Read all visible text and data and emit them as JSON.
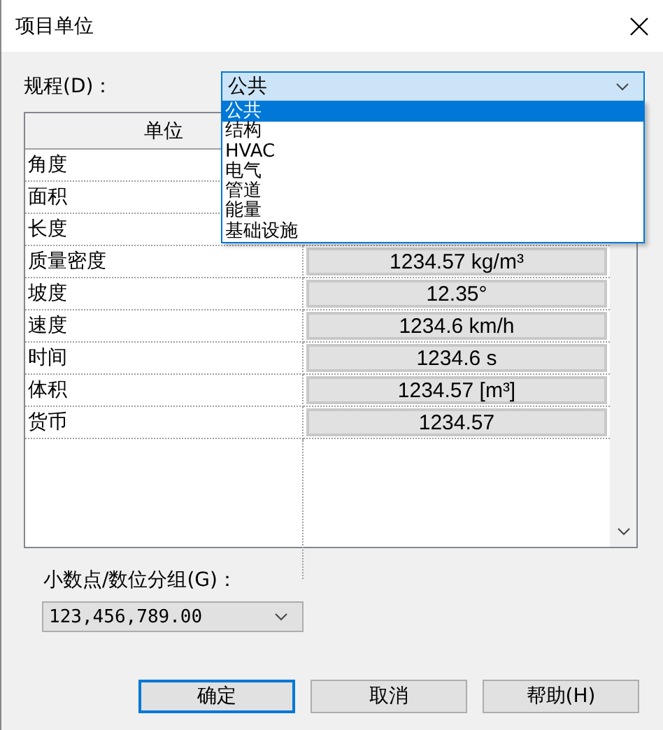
{
  "window": {
    "title": "项目单位"
  },
  "discipline": {
    "label": "规程(D)：",
    "value": "公共",
    "expanded": true,
    "options": [
      {
        "label": "公共",
        "selected": true
      },
      {
        "label": "结构",
        "selected": false
      },
      {
        "label": "HVAC",
        "selected": false
      },
      {
        "label": "电气",
        "selected": false
      },
      {
        "label": "管道",
        "selected": false
      },
      {
        "label": "能量",
        "selected": false
      },
      {
        "label": "基础设施",
        "selected": false
      }
    ]
  },
  "table": {
    "columns": [
      "单位"
    ],
    "rows": [
      {
        "name": "角度"
      },
      {
        "name": "面积"
      },
      {
        "name": "长度"
      },
      {
        "name": "质量密度",
        "value": "1234.57 kg/m³"
      },
      {
        "name": "坡度",
        "value": "12.35°"
      },
      {
        "name": "速度",
        "value": "1234.6 km/h"
      },
      {
        "name": "时间",
        "value": "1234.6 s"
      },
      {
        "name": "体积",
        "value": "1234.57 [m³]"
      },
      {
        "name": "货币",
        "value": "1234.57"
      }
    ]
  },
  "grouping": {
    "label": "小数点/数位分组(G)：",
    "value": "123,456,789.00"
  },
  "buttons": [
    {
      "label": "确定",
      "default": true
    },
    {
      "label": "取消",
      "default": false
    },
    {
      "label": "帮助(H)",
      "default": false
    }
  ]
}
